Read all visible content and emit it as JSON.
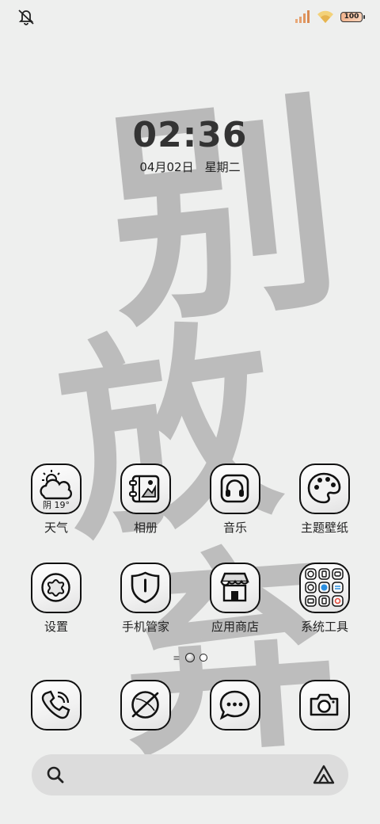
{
  "wallpaper": {
    "characters": [
      "别",
      "放",
      "弃"
    ],
    "ink_color": "#b9b9b9",
    "background": "#eeefee"
  },
  "status_bar": {
    "battery": "100"
  },
  "clock": {
    "time": "02:36",
    "date": "04月02日",
    "weekday": "星期二"
  },
  "weather": {
    "condition": "阴",
    "temperature": "19°"
  },
  "apps_row1": [
    "天气",
    "相册",
    "音乐",
    "主题壁纸"
  ],
  "apps_row2": [
    "设置",
    "手机管家",
    "应用商店",
    "系统工具"
  ],
  "colors": {
    "icon_border": "#111111",
    "search_bar_bg": "#dcdcdc",
    "tool_blue": "#2b8fe0",
    "tool_red": "#e34b3b"
  }
}
